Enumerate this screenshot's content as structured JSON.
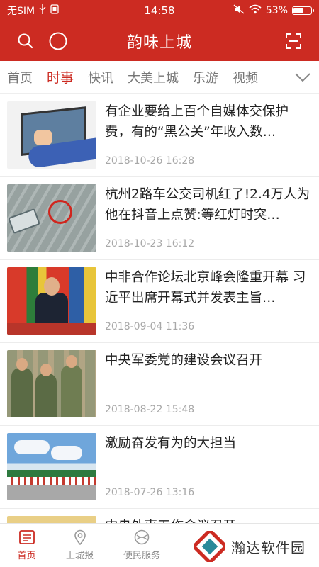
{
  "status_bar": {
    "carrier": "无SIM",
    "time": "14:58",
    "battery": "53%"
  },
  "header": {
    "title": "韵味上城"
  },
  "tabs": [
    {
      "label": "首页"
    },
    {
      "label": "时事"
    },
    {
      "label": "快讯"
    },
    {
      "label": "大美上城"
    },
    {
      "label": "乐游"
    },
    {
      "label": "视频"
    }
  ],
  "active_tab_index": 1,
  "news": [
    {
      "title": "有企业要给上百个自媒体交保护费，有的“黑公关”年收入数…",
      "date": "2018-10-26 16:28"
    },
    {
      "title": "杭州2路车公交司机红了!2.4万人为他在抖音上点赞:等红灯时突…",
      "date": "2018-10-23 16:12"
    },
    {
      "title": "中非合作论坛北京峰会隆重开幕 习近平出席开幕式并发表主旨…",
      "date": "2018-09-04 11:36"
    },
    {
      "title": "中央军委党的建设会议召开",
      "date": "2018-08-22 15:48"
    },
    {
      "title": "激励奋发有为的大担当",
      "date": "2018-07-26 13:16"
    },
    {
      "title": "中央外事工作会议召开",
      "date": ""
    }
  ],
  "bottom_nav": [
    {
      "label": "首页",
      "icon": "home-icon"
    },
    {
      "label": "上城报",
      "icon": "location-pin-icon"
    },
    {
      "label": "便民服务",
      "icon": "service-icon"
    }
  ],
  "watermark": {
    "text": "瀚达软件园"
  },
  "colors": {
    "brand_red": "#cc2b22",
    "tab_inactive": "#777777",
    "date_gray": "#a8a8a8"
  }
}
